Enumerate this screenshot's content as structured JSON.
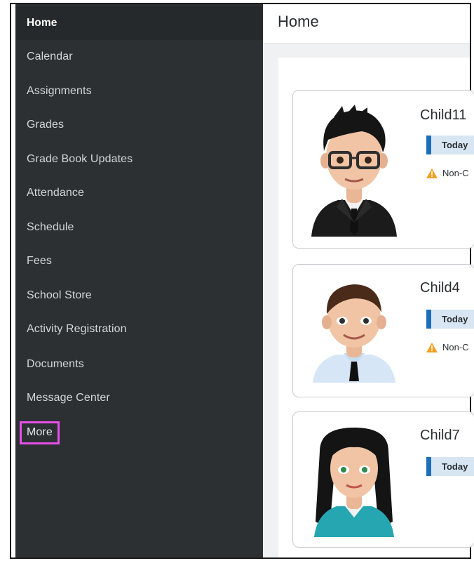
{
  "sidebar": {
    "items": [
      {
        "label": "Home",
        "active": true
      },
      {
        "label": "Calendar"
      },
      {
        "label": "Assignments"
      },
      {
        "label": "Grades"
      },
      {
        "label": "Grade Book Updates"
      },
      {
        "label": "Attendance"
      },
      {
        "label": "Schedule"
      },
      {
        "label": "Fees"
      },
      {
        "label": "School Store"
      },
      {
        "label": "Activity Registration"
      },
      {
        "label": "Documents"
      },
      {
        "label": "Message Center"
      },
      {
        "label": "More",
        "highlighted": true
      }
    ]
  },
  "header": {
    "title": "Home"
  },
  "children": [
    {
      "name": "Child11",
      "badge": "Today",
      "alert": "Non-C",
      "avatar": "boy-with-glasses-suit-icon"
    },
    {
      "name": "Child4",
      "badge": "Today",
      "alert": "Non-C",
      "avatar": "boy-shirt-tie-icon"
    },
    {
      "name": "Child7",
      "badge": "Today",
      "avatar": "girl-teal-top-icon"
    }
  ],
  "colors": {
    "sidebar_bg": "#2c3033",
    "accent_blue": "#1c6fb8",
    "highlight_pink": "#e84fe6",
    "warning": "#f0a020"
  }
}
